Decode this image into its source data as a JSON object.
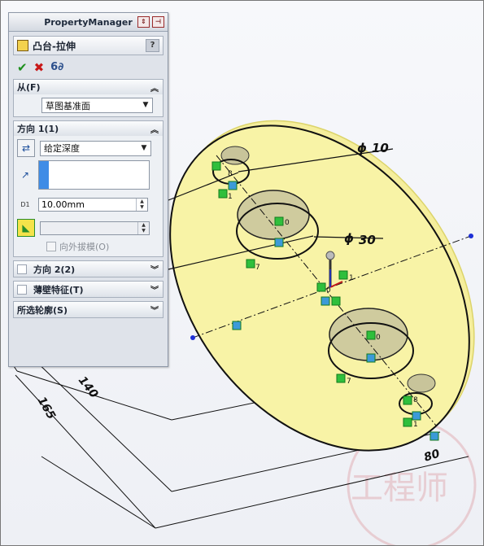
{
  "property_manager": {
    "title": "PropertyManager",
    "feature_name": "凸台-拉伸",
    "help_label": "?",
    "icons": {
      "ok": "check-icon",
      "cancel": "close-icon",
      "preview": "detailed-preview-icon"
    },
    "from_section": {
      "label": "从(F)",
      "value": "草图基准面"
    },
    "direction1": {
      "label": "方向 1(1)",
      "end_condition": "给定深度",
      "depth": "10.00mm",
      "draft_label": "向外拔模(O)",
      "depth_tag": "D1"
    },
    "direction2": {
      "label": "方向 2(2)"
    },
    "thin_feature": {
      "label": "薄壁特征(T)"
    },
    "selected_contours": {
      "label": "所选轮廓(S)"
    }
  },
  "dimensions": {
    "dia_small": "10",
    "dia_large": "30",
    "len_140": "140",
    "len_165": "165",
    "len_80": "80",
    "dia_symbol": "ϕ"
  },
  "relation_tags": {
    "zero": "0",
    "one": "1",
    "seven": "7",
    "eight": "8"
  },
  "watermark": {
    "text": "工程师"
  },
  "colors": {
    "face": "#f8f3a0",
    "edge": "#e4de6a",
    "relation_green": "#2fbf3c",
    "blue_point": "#1d2fd6"
  }
}
